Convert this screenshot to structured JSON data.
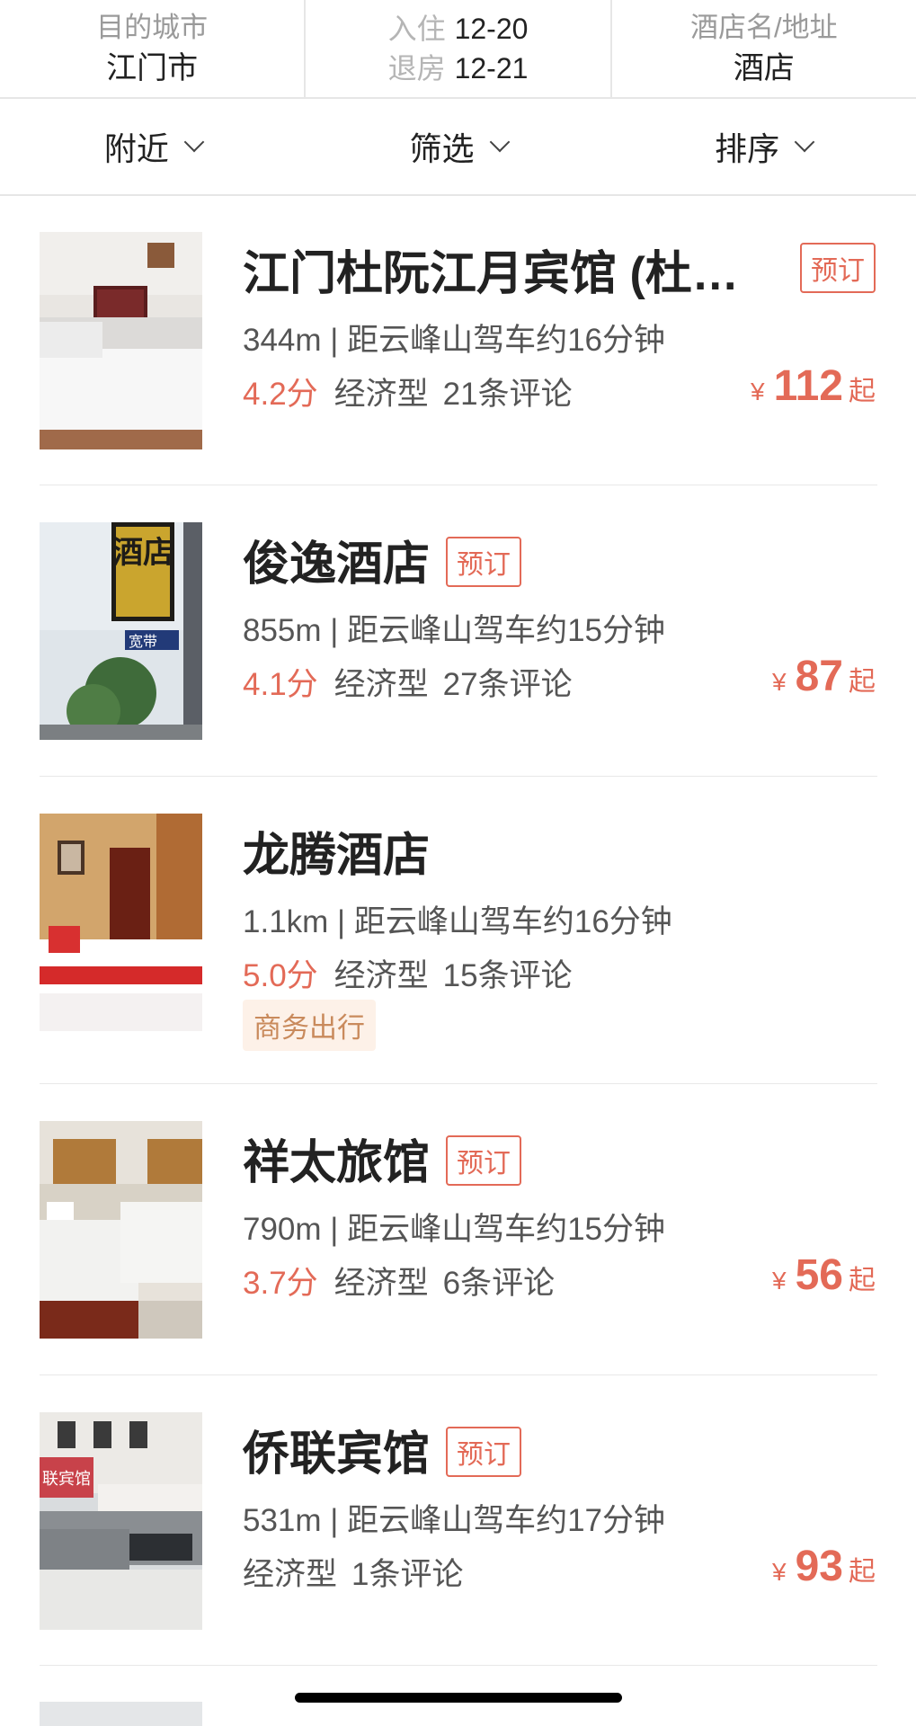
{
  "search": {
    "city_label": "目的城市",
    "city_value": "江门市",
    "checkin_label": "入住",
    "checkin_value": "12-20",
    "checkout_label": "退房",
    "checkout_value": "12-21",
    "keyword_label": "酒店名/地址",
    "keyword_value": "酒店"
  },
  "filters": [
    {
      "label": "附近"
    },
    {
      "label": "筛选"
    },
    {
      "label": "排序"
    }
  ],
  "hotels": [
    {
      "name": "江门杜阮江月宾馆 (杜…",
      "book_tag": "预订",
      "distance": "344m | 距云峰山驾车约16分钟",
      "score": "4.2分",
      "type": "经济型",
      "reviews": "21条评论",
      "currency": "¥",
      "price": "112",
      "price_suffix": "起"
    },
    {
      "name": "俊逸酒店",
      "book_tag": "预订",
      "distance": "855m | 距云峰山驾车约15分钟",
      "score": "4.1分",
      "type": "经济型",
      "reviews": "27条评论",
      "currency": "¥",
      "price": "87",
      "price_suffix": "起"
    },
    {
      "name": "龙腾酒店",
      "distance": "1.1km | 距云峰山驾车约16分钟",
      "score": "5.0分",
      "type": "经济型",
      "reviews": "15条评论",
      "feature": "商务出行"
    },
    {
      "name": "祥太旅馆",
      "book_tag": "预订",
      "distance": "790m | 距云峰山驾车约15分钟",
      "score": "3.7分",
      "type": "经济型",
      "reviews": "6条评论",
      "currency": "¥",
      "price": "56",
      "price_suffix": "起"
    },
    {
      "name": "侨联宾馆",
      "book_tag": "预订",
      "distance": "531m | 距云峰山驾车约17分钟",
      "type": "经济型",
      "reviews": "1条评论",
      "currency": "¥",
      "price": "93",
      "price_suffix": "起"
    }
  ],
  "photo_signs": {
    "hotel2_sign": "酒店",
    "hotel2_sign2": "宽带",
    "hotel5_sign": "联宾馆"
  },
  "colors": {
    "accent": "#e36a57",
    "feature_bg": "#fdf1e8",
    "feature_text": "#c98a5c"
  }
}
